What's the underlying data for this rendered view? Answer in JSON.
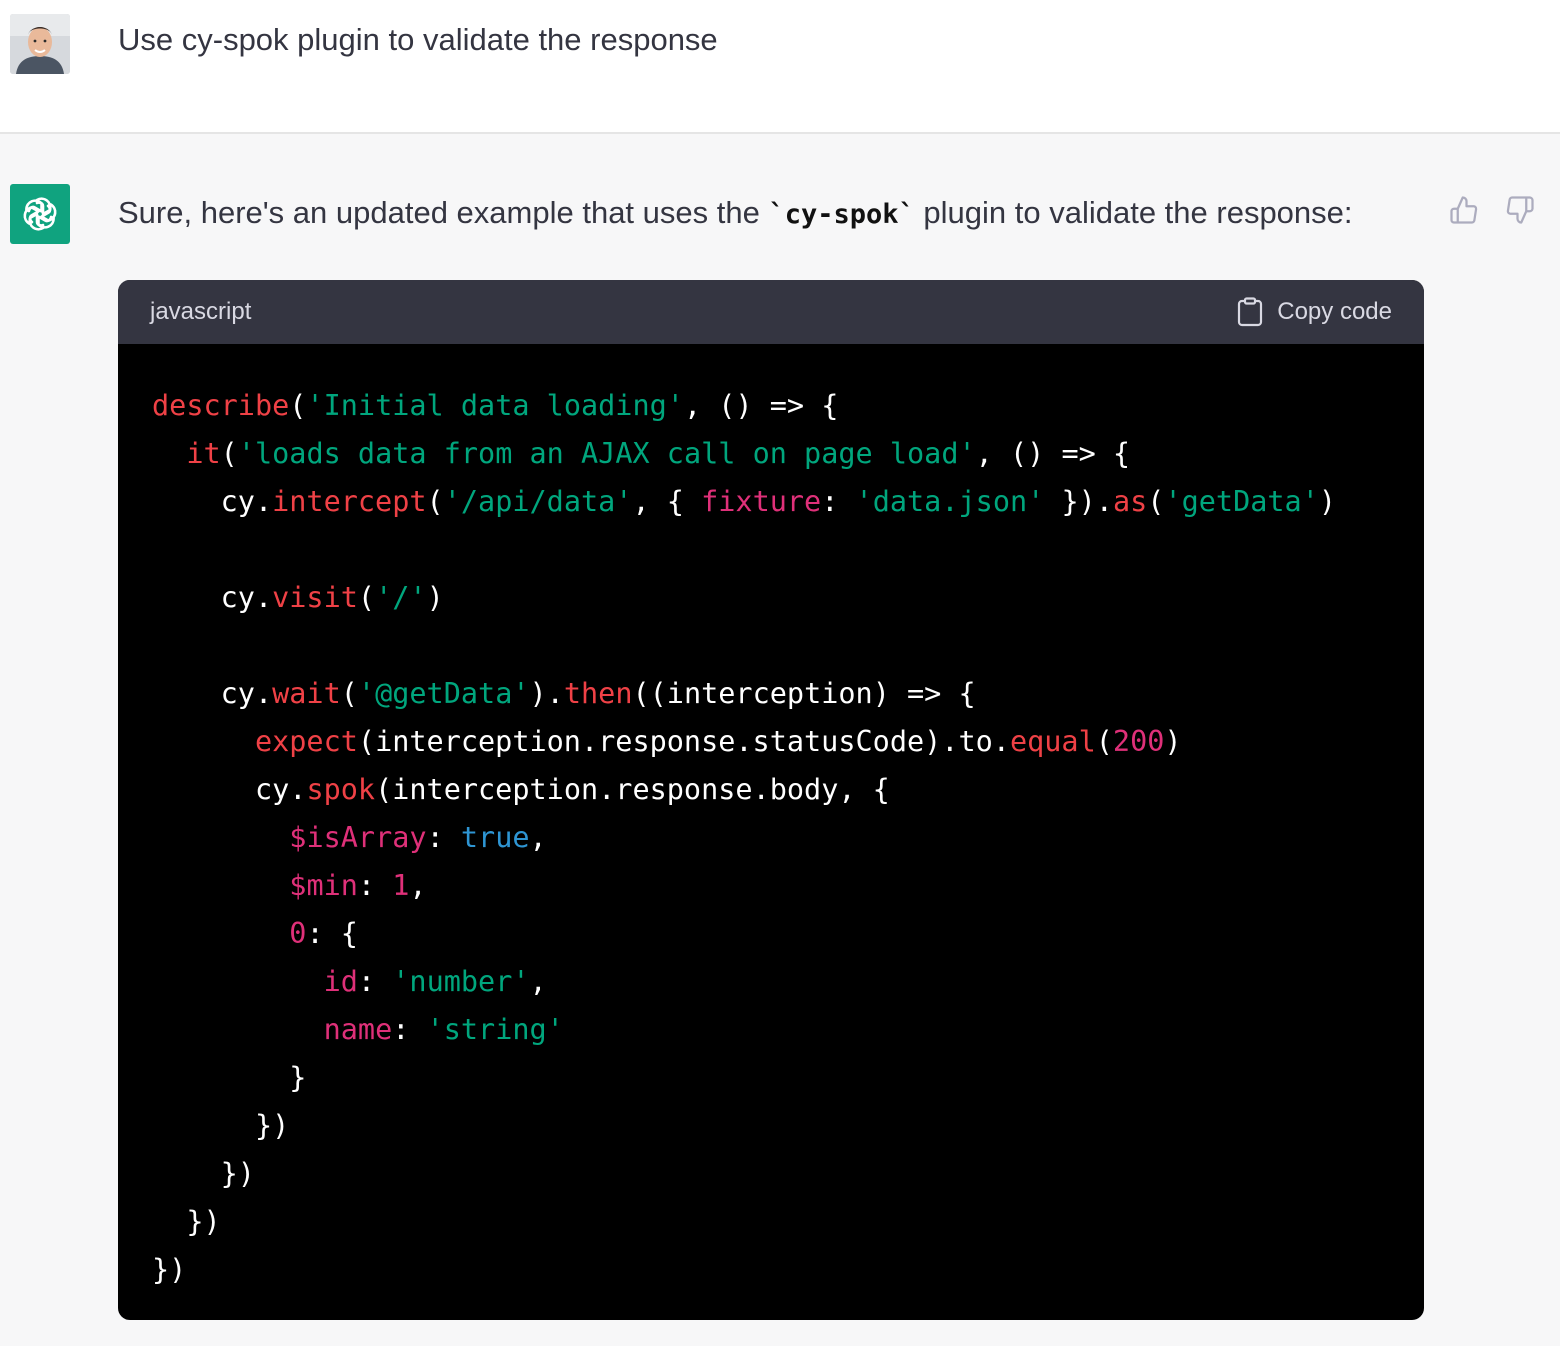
{
  "user_message": {
    "text": "Use cy-spok plugin to validate the response"
  },
  "assistant_message": {
    "intro_before": "Sure, here's an updated example that uses the ",
    "intro_code": "`cy-spok`",
    "intro_after": " plugin to validate the response:"
  },
  "code_block": {
    "language": "javascript",
    "copy_label": "Copy code",
    "lines": [
      [
        [
          "fn",
          "describe"
        ],
        [
          "plain",
          "("
        ],
        [
          "str",
          "'Initial data loading'"
        ],
        [
          "plain",
          ", () => {"
        ]
      ],
      [
        [
          "plain",
          "  "
        ],
        [
          "fn",
          "it"
        ],
        [
          "plain",
          "("
        ],
        [
          "str",
          "'loads data from an AJAX call on page load'"
        ],
        [
          "plain",
          ", () => {"
        ]
      ],
      [
        [
          "plain",
          "    cy."
        ],
        [
          "fn",
          "intercept"
        ],
        [
          "plain",
          "("
        ],
        [
          "str",
          "'/api/data'"
        ],
        [
          "plain",
          ", { "
        ],
        [
          "prop",
          "fixture"
        ],
        [
          "plain",
          ": "
        ],
        [
          "str",
          "'data.json'"
        ],
        [
          "plain",
          " })."
        ],
        [
          "fn",
          "as"
        ],
        [
          "plain",
          "("
        ],
        [
          "str",
          "'getData'"
        ],
        [
          "plain",
          ")"
        ]
      ],
      [
        [
          "plain",
          ""
        ]
      ],
      [
        [
          "plain",
          "    cy."
        ],
        [
          "fn",
          "visit"
        ],
        [
          "plain",
          "("
        ],
        [
          "str",
          "'/'"
        ],
        [
          "plain",
          ")"
        ]
      ],
      [
        [
          "plain",
          ""
        ]
      ],
      [
        [
          "plain",
          "    cy."
        ],
        [
          "fn",
          "wait"
        ],
        [
          "plain",
          "("
        ],
        [
          "str",
          "'@getData'"
        ],
        [
          "plain",
          ")."
        ],
        [
          "fn",
          "then"
        ],
        [
          "plain",
          "((interception) => {"
        ]
      ],
      [
        [
          "plain",
          "      "
        ],
        [
          "fn",
          "expect"
        ],
        [
          "plain",
          "(interception.response.statusCode).to."
        ],
        [
          "fn",
          "equal"
        ],
        [
          "plain",
          "("
        ],
        [
          "num",
          "200"
        ],
        [
          "plain",
          ")"
        ]
      ],
      [
        [
          "plain",
          "      cy."
        ],
        [
          "fn",
          "spok"
        ],
        [
          "plain",
          "(interception.response.body, {"
        ]
      ],
      [
        [
          "plain",
          "        "
        ],
        [
          "prop",
          "$isArray"
        ],
        [
          "plain",
          ": "
        ],
        [
          "bool",
          "true"
        ],
        [
          "plain",
          ","
        ]
      ],
      [
        [
          "plain",
          "        "
        ],
        [
          "prop",
          "$min"
        ],
        [
          "plain",
          ": "
        ],
        [
          "num",
          "1"
        ],
        [
          "plain",
          ","
        ]
      ],
      [
        [
          "plain",
          "        "
        ],
        [
          "num",
          "0"
        ],
        [
          "plain",
          ": {"
        ]
      ],
      [
        [
          "plain",
          "          "
        ],
        [
          "prop",
          "id"
        ],
        [
          "plain",
          ": "
        ],
        [
          "str",
          "'number'"
        ],
        [
          "plain",
          ","
        ]
      ],
      [
        [
          "plain",
          "          "
        ],
        [
          "prop",
          "name"
        ],
        [
          "plain",
          ": "
        ],
        [
          "str",
          "'string'"
        ]
      ],
      [
        [
          "plain",
          "        }"
        ]
      ],
      [
        [
          "plain",
          "      })"
        ]
      ],
      [
        [
          "plain",
          "    })"
        ]
      ],
      [
        [
          "plain",
          "  })"
        ]
      ],
      [
        [
          "plain",
          "})"
        ]
      ]
    ]
  },
  "icons": {
    "assistant_avatar": "openai-logo-icon",
    "copy": "clipboard-icon",
    "thumb_up": "thumbs-up-icon",
    "thumb_down": "thumbs-down-icon"
  },
  "colors": {
    "assistant_avatar_bg": "#10a37f",
    "code_bg": "#000000",
    "code_header_bg": "#343541",
    "token_function": "#ef4146",
    "token_string": "#00a67d",
    "token_property": "#df3079",
    "token_boolean": "#2e95d3"
  }
}
